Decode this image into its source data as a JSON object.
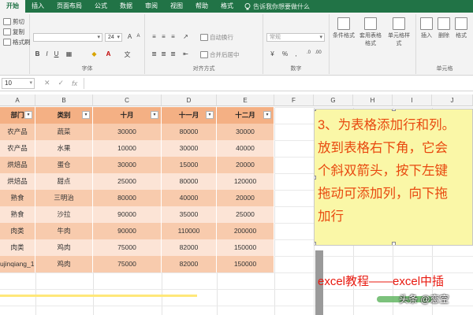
{
  "ribbon": {
    "tabs": [
      "开始",
      "插入",
      "页面布局",
      "公式",
      "数据",
      "审阅",
      "视图",
      "帮助",
      "格式"
    ],
    "active_tab": 0,
    "tell_me": "告诉我你想要做什么",
    "clipboard": {
      "cut": "剪切",
      "copy": "复制",
      "painter": "格式刷"
    },
    "font": {
      "size": "24",
      "bold": "B",
      "italic": "I",
      "underline": "U"
    },
    "alignment": {
      "wrap": "自动换行",
      "merge": "合并后居中"
    },
    "number": {
      "format": "常规"
    },
    "styles": {
      "conditional": "条件格式",
      "as_table": "套用表格格式",
      "cell_styles": "单元格样式"
    },
    "cells": {
      "insert": "插入",
      "delete": "删除",
      "format": "格式"
    },
    "group_labels": {
      "font": "字体",
      "alignment": "对齐方式",
      "number": "数字",
      "cells": "单元格"
    }
  },
  "formula_bar": {
    "name_box": "10",
    "cancel": "✕",
    "enter": "✓",
    "fx": "fx"
  },
  "sheet": {
    "columns": [
      "A",
      "B",
      "C",
      "D",
      "E",
      "F",
      "G",
      "H",
      "I",
      "J"
    ],
    "table": {
      "headers": [
        "部门",
        "类别",
        "十月",
        "十一月",
        "十二月"
      ],
      "rows": [
        [
          "农产品",
          "蔬菜",
          "30000",
          "80000",
          "30000"
        ],
        [
          "农产品",
          "水果",
          "10000",
          "30000",
          "40000"
        ],
        [
          "烘焙品",
          "蛋仓",
          "30000",
          "15000",
          "20000"
        ],
        [
          "烘焙品",
          "甜点",
          "25000",
          "80000",
          "120000"
        ],
        [
          "熟食",
          "三明治",
          "80000",
          "40000",
          "20000"
        ],
        [
          "熟食",
          "沙拉",
          "90000",
          "35000",
          "25000"
        ],
        [
          "肉类",
          "牛肉",
          "90000",
          "110000",
          "200000"
        ],
        [
          "肉类",
          "鸡肉",
          "75000",
          "82000",
          "150000"
        ],
        [
          "ujinqiang_1",
          "鸡肉",
          "75000",
          "82000",
          "150000"
        ]
      ]
    }
  },
  "note": {
    "text": "3、为表格添加行和列。\n放到表格右下角，它会\n个斜双箭头，按下左键\n拖动可添加列，向下拖\n加行"
  },
  "caption": "excel教程——excel中插",
  "watermark": "头条 @恋空",
  "colors": {
    "ribbon_green": "#217346",
    "header_fill": "#f4b084",
    "row_dark": "#f8cbad",
    "row_light": "#fce4d6",
    "note_fill": "#faf7a7",
    "note_text": "#e8490f"
  }
}
